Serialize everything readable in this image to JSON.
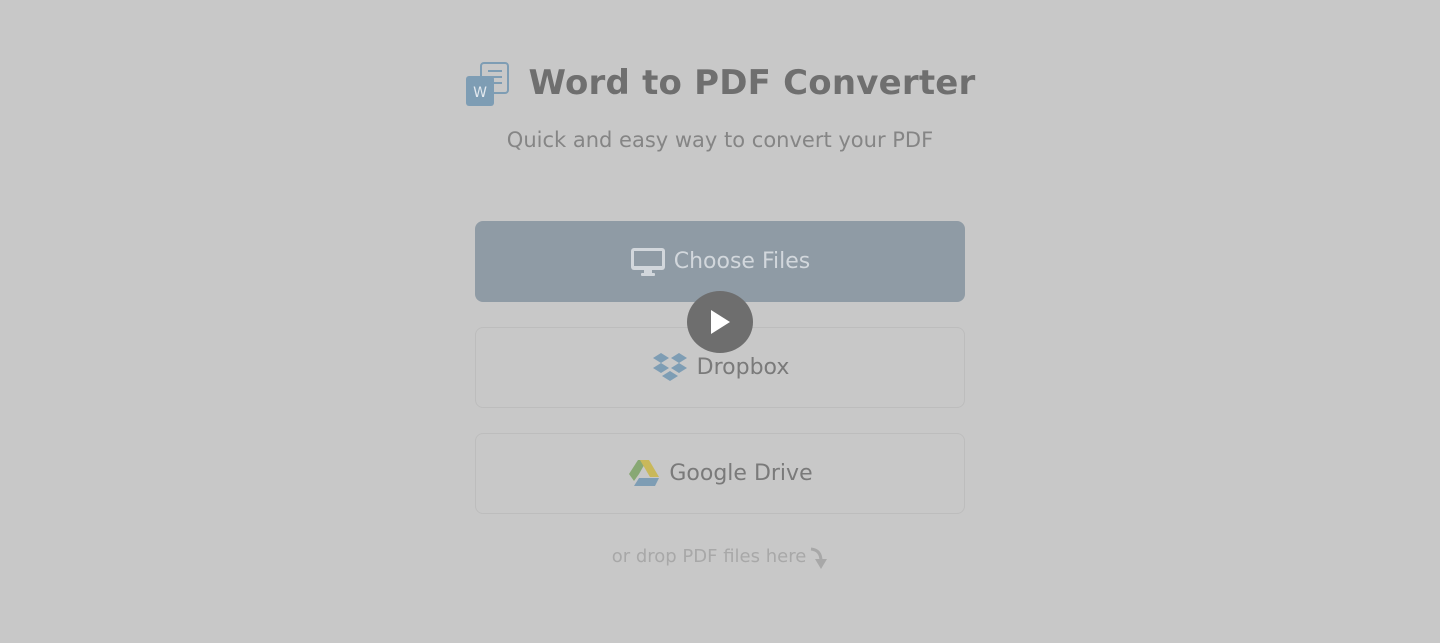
{
  "header": {
    "title": "Word to PDF Converter",
    "subtitle": "Quick and easy way to convert your PDF",
    "logo_icon": "word-document-icon",
    "logo_letter": "W"
  },
  "upload": {
    "choose_files_label": "Choose Files",
    "choose_files_icon": "monitor-icon",
    "dropbox_label": "Dropbox",
    "dropbox_icon": "dropbox-icon",
    "google_drive_label": "Google Drive",
    "google_drive_icon": "google-drive-icon",
    "drop_hint": "or drop PDF files here",
    "drop_hint_icon": "curved-arrow-down-icon"
  },
  "overlay": {
    "play_icon": "play-icon"
  },
  "colors": {
    "background": "#c8c8c8",
    "primary_button": "#8f9ba5",
    "title_text": "#6f6f6f",
    "logo_blue": "#7e9db4"
  }
}
